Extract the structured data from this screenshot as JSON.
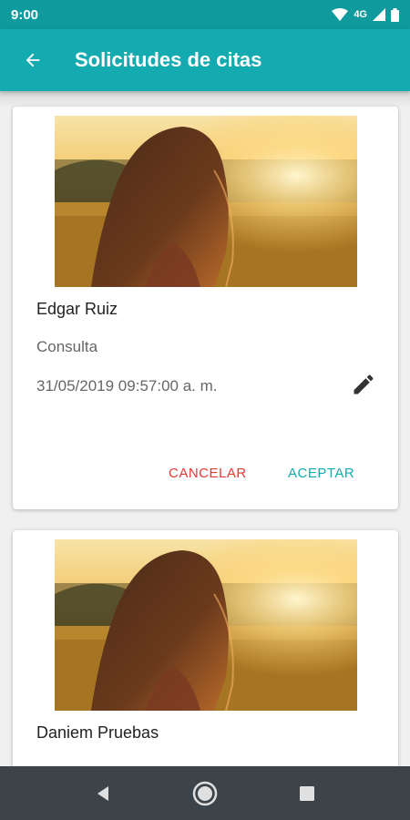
{
  "status_bar": {
    "time": "9:00",
    "network": "4G"
  },
  "app_bar": {
    "title": "Solicitudes de citas",
    "back_icon": "arrow-back-icon"
  },
  "appointments": [
    {
      "name": "Edgar Ruiz",
      "type": "Consulta",
      "datetime": "31/05/2019 09:57:00 a. m.",
      "edit_icon": "pencil-icon",
      "cancel_label": "CANCELAR",
      "accept_label": "ACEPTAR"
    },
    {
      "name": "Daniem Pruebas"
    }
  ],
  "colors": {
    "primary": "#14abb0",
    "status_bar": "#0f9b9d",
    "cancel": "#e53935",
    "nav_bar": "#3c4449"
  },
  "nav_bar": {
    "back_icon": "triangle-back-icon",
    "home_icon": "circle-home-icon",
    "recents_icon": "square-recents-icon"
  }
}
